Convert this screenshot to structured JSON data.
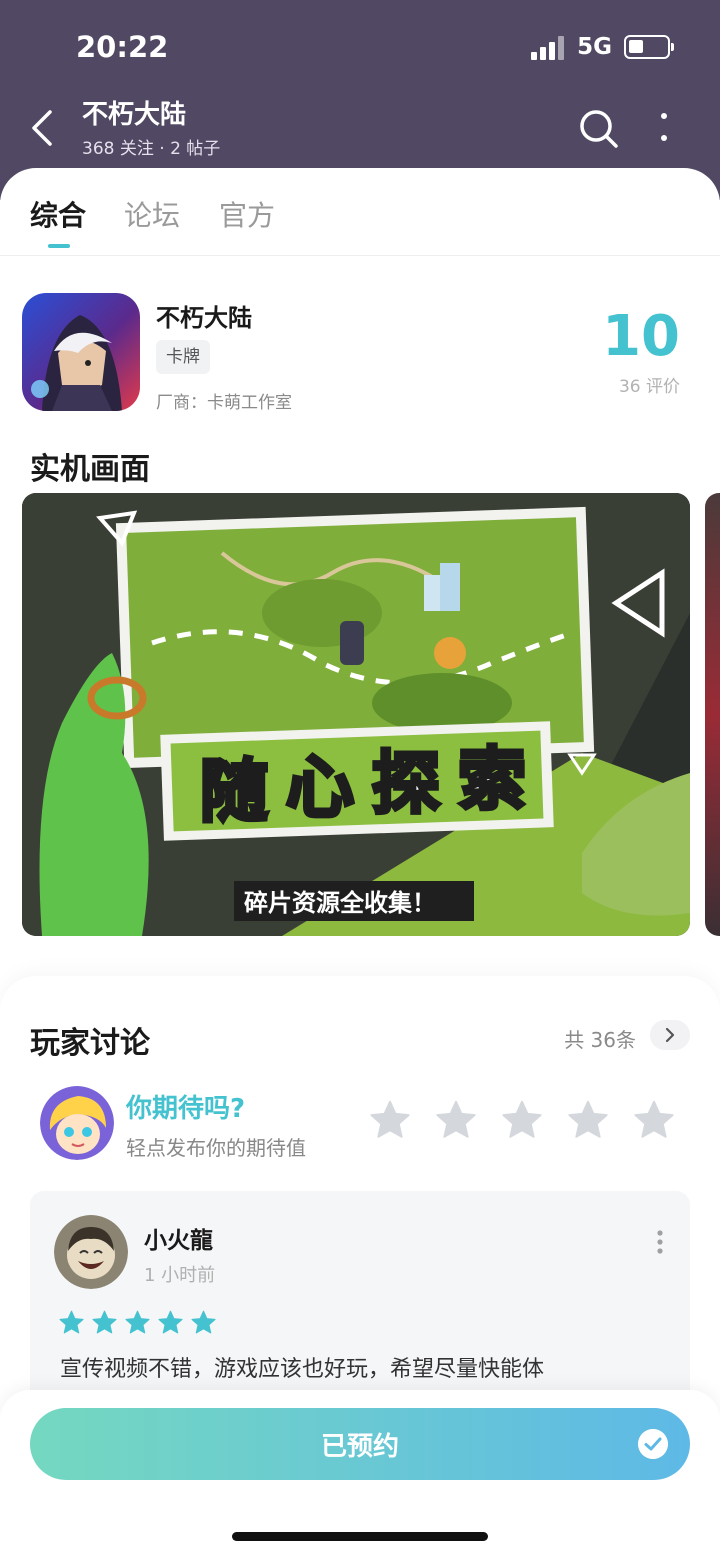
{
  "status_bar": {
    "time": "20:22",
    "network": "5G"
  },
  "header": {
    "title": "不朽大陆",
    "subtitle": "368 关注 · 2 帖子"
  },
  "tabs": [
    {
      "label": "综合",
      "active": true
    },
    {
      "label": "论坛",
      "active": false
    },
    {
      "label": "官方",
      "active": false
    }
  ],
  "game": {
    "name": "不朽大陆",
    "genre": "卡牌",
    "developer": "厂商：卡萌工作室",
    "score": "10",
    "reviews": "36 评价"
  },
  "screenshots": {
    "section_title": "实机画面",
    "banner_chars": [
      "随",
      "心",
      "探",
      "索"
    ],
    "banner_sub": "碎片资源全收集！"
  },
  "discussion": {
    "title": "玩家讨论",
    "count": "共 36条",
    "prompt_question": "你期待吗?",
    "prompt_sub": "轻点发布你的期待值",
    "rating_stars": 5,
    "post": {
      "user": "小火龍",
      "time": "1 小时前",
      "rating": 5,
      "text": "宣传视频不错，游戏应该也好玩，希望尽量快能体"
    }
  },
  "action": {
    "label": "已预约"
  },
  "colors": {
    "header_bg": "#514863",
    "accent": "#45c2cf",
    "cta_start": "#74d8c0",
    "cta_end": "#5eb9e6"
  }
}
